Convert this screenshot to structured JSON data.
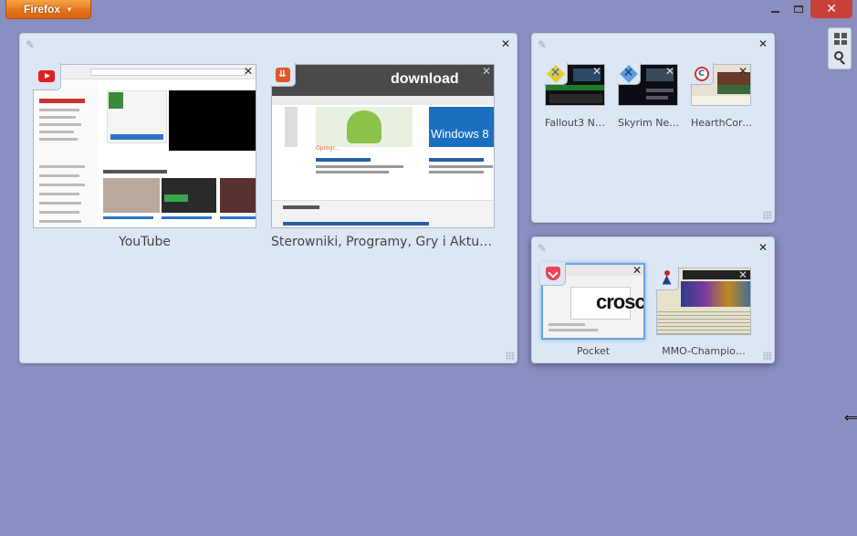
{
  "titlebar": {
    "app_button_label": "Firefox",
    "close_glyph": "✕"
  },
  "side_tools": {
    "icons": [
      "group-view-icon",
      "search-icon"
    ]
  },
  "groups": [
    {
      "name": "group-1",
      "tabs": [
        {
          "title": "YouTube",
          "favicon": "youtube-icon"
        },
        {
          "title": "Sterowniki, Programy, Gry i Aktual…",
          "favicon": "dobreprogramy-icon",
          "thumb_texts": {
            "logo": "download",
            "label1": "Oprogr...",
            "label2": "Windows 8"
          }
        }
      ]
    },
    {
      "name": "group-2",
      "tabs": [
        {
          "title": "Fallout3 Nexus…",
          "favicon": "nexus-icon"
        },
        {
          "title": "Skyrim Nexus…",
          "favicon": "nexus-icon"
        },
        {
          "title": "HearthCore - …",
          "favicon": "hearthcore-icon"
        }
      ]
    },
    {
      "name": "group-3",
      "tabs": [
        {
          "title": "Pocket",
          "favicon": "pocket-icon",
          "thumb_texts": {
            "big": "crosc"
          }
        },
        {
          "title": "MMO-Champio…",
          "favicon": "mmo-champion-icon"
        }
      ]
    }
  ],
  "colors": {
    "background": "#8b8ec0",
    "group_bg": "#dce7f3",
    "firefox_button": "#e4761b",
    "close_button": "#c7403a",
    "selected_tab_border": "#6aa2e2"
  }
}
